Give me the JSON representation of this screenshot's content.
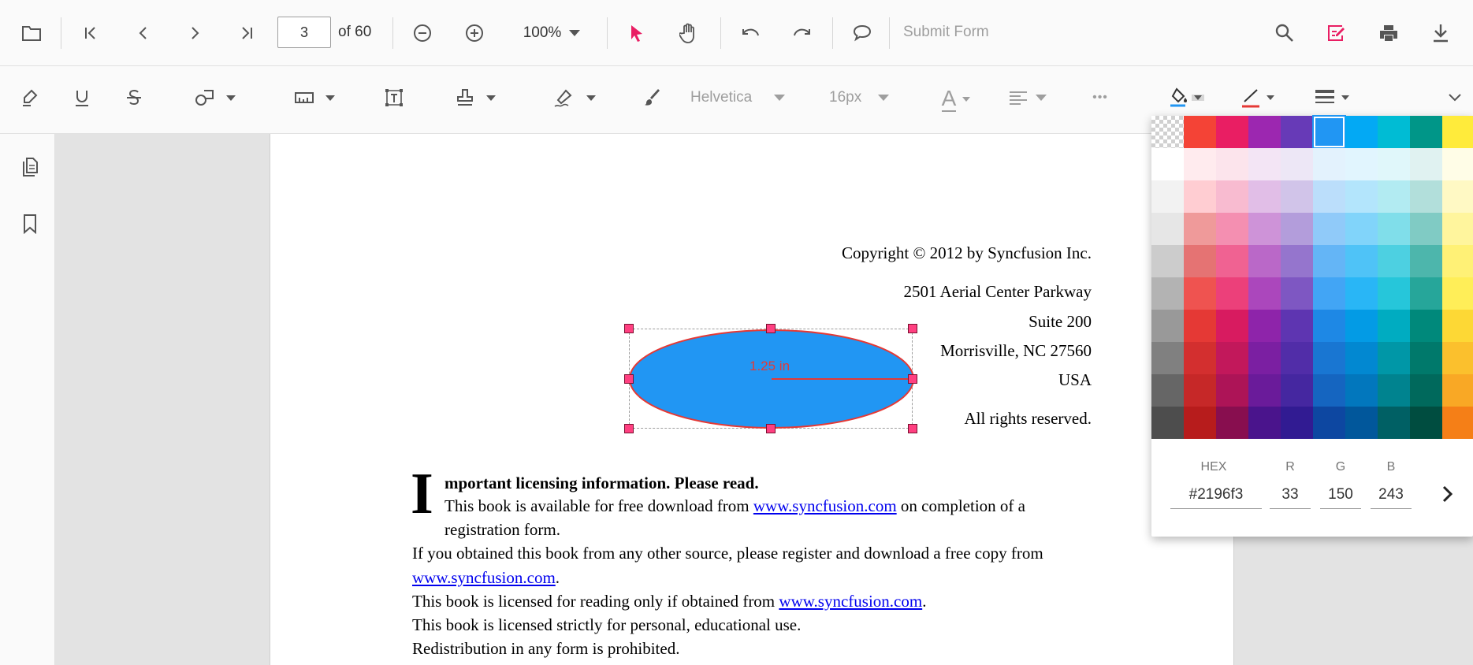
{
  "toolbar": {
    "page_current": "3",
    "page_total": "of 60",
    "zoom": "100%",
    "submit_form": "Submit Form"
  },
  "annotation_toolbar": {
    "font_family": "Helvetica",
    "font_size": "16px",
    "font_color_glyph": "A",
    "more_glyph": "•••"
  },
  "colors": {
    "accent": "#e91e63",
    "selected_fill": "#2196f3",
    "ellipse_stroke": "#e53935"
  },
  "document": {
    "copyright": "Copyright © 2012 by Syncfusion Inc.",
    "address1": "2501 Aerial Center Parkway",
    "address2": "Suite 200",
    "address3": "Morrisville, NC 27560",
    "country": "USA",
    "rights": "All rights reserved.",
    "dropcap": "I",
    "heading": "mportant licensing information. Please read.",
    "line1a": "This book is available for free download from ",
    "link": "www.syncfusion.com",
    "line1b": " on completion of a",
    "line1c": "registration form.",
    "line2": "If you obtained this book from any other source, please register and download a free copy from",
    "period": ".",
    "line3a": "This book is licensed for reading only if obtained from ",
    "line4": "This book is licensed strictly for personal, educational use.",
    "line5": "Redistribution in any form is prohibited."
  },
  "shape": {
    "measure_label": "1.25 in"
  },
  "color_picker": {
    "hex_label": "HEX",
    "r_label": "R",
    "g_label": "G",
    "b_label": "B",
    "hex": "#2196f3",
    "r": "33",
    "g": "150",
    "b": "243",
    "selected_color": "#2196f3",
    "palette": [
      [
        "transparent",
        "#f44336",
        "#e91e63",
        "#9c27b0",
        "#673ab7",
        "#2196f3",
        "#03a9f4",
        "#00bcd4",
        "#009688",
        "#ffeb3b"
      ],
      [
        "#ffffff",
        "#ffebee",
        "#fce4ec",
        "#f3e5f5",
        "#ede7f6",
        "#e3f2fd",
        "#e1f5fe",
        "#e0f7fa",
        "#e0f2f1",
        "#fffde7"
      ],
      [
        "#f2f2f2",
        "#ffcdd2",
        "#f8bbd0",
        "#e1bee7",
        "#d1c4e9",
        "#bbdefb",
        "#b3e5fc",
        "#b2ebf2",
        "#b2dfdb",
        "#fff9c4"
      ],
      [
        "#e6e6e6",
        "#ef9a9a",
        "#f48fb1",
        "#ce93d8",
        "#b39ddb",
        "#90caf9",
        "#81d4fa",
        "#80deea",
        "#80cbc4",
        "#fff59d"
      ],
      [
        "#cccccc",
        "#e57373",
        "#f06292",
        "#ba68c8",
        "#9575cd",
        "#64b5f6",
        "#4fc3f7",
        "#4dd0e1",
        "#4db6ac",
        "#fff176"
      ],
      [
        "#b3b3b3",
        "#ef5350",
        "#ec407a",
        "#ab47bc",
        "#7e57c2",
        "#42a5f5",
        "#29b6f6",
        "#26c6da",
        "#26a69a",
        "#ffee58"
      ],
      [
        "#999999",
        "#e53935",
        "#d81b60",
        "#8e24aa",
        "#5e35b1",
        "#1e88e5",
        "#039be5",
        "#00acc1",
        "#00897b",
        "#fdd835"
      ],
      [
        "#808080",
        "#d32f2f",
        "#c2185b",
        "#7b1fa2",
        "#512da8",
        "#1976d2",
        "#0288d1",
        "#0097a7",
        "#00796b",
        "#fbc02d"
      ],
      [
        "#666666",
        "#c62828",
        "#ad1457",
        "#6a1b9a",
        "#4527a0",
        "#1565c0",
        "#0277bd",
        "#00838f",
        "#00695c",
        "#f9a825"
      ],
      [
        "#4d4d4d",
        "#b71c1c",
        "#880e4f",
        "#4a148c",
        "#311b92",
        "#0d47a1",
        "#01579b",
        "#006064",
        "#004d40",
        "#f57f17"
      ]
    ]
  }
}
